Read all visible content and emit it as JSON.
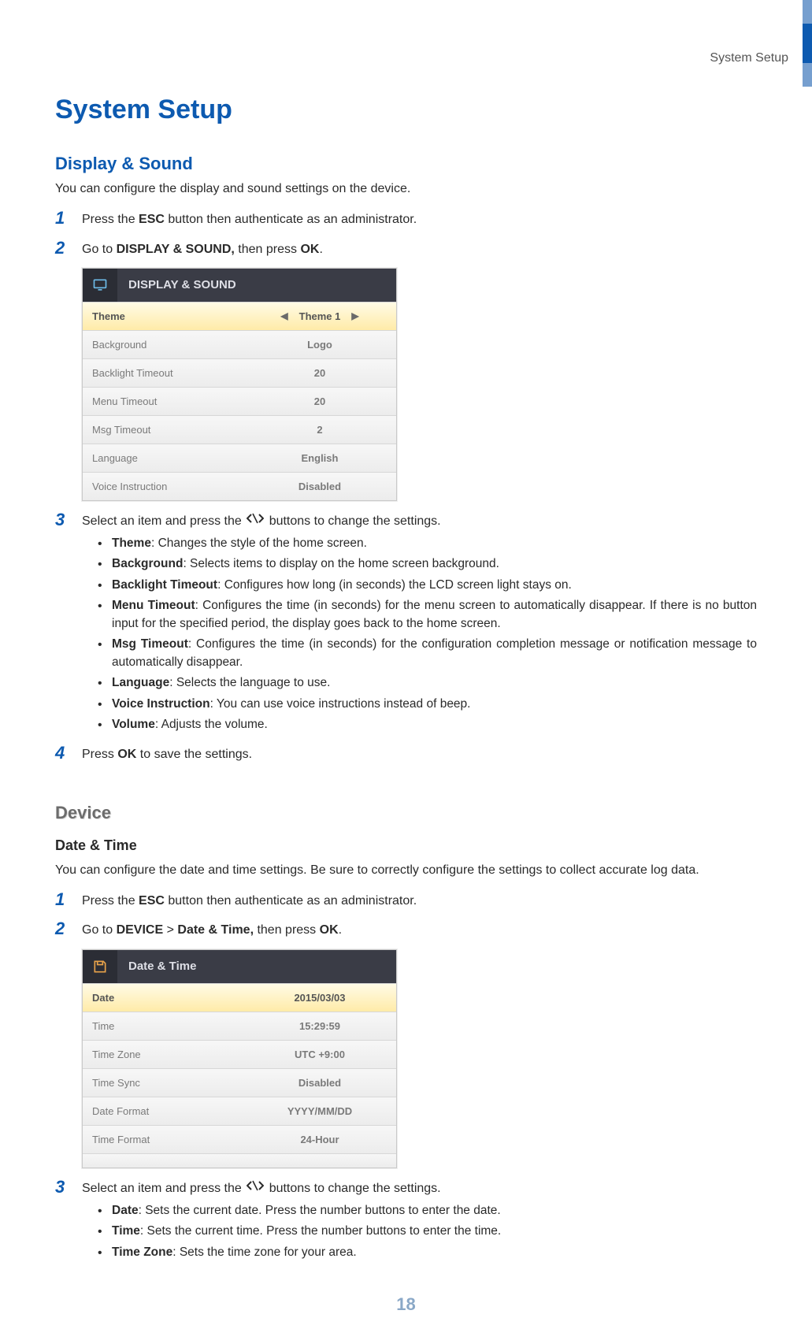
{
  "header": {
    "section": "System Setup"
  },
  "page_number": "18",
  "h1": "System Setup",
  "display_sound": {
    "heading": "Display & Sound",
    "intro": "You can configure the display and sound settings on the device.",
    "steps": {
      "s1_a": "Press the ",
      "s1_b": "ESC",
      "s1_c": " button then authenticate as an administrator.",
      "s2_a": "Go to ",
      "s2_b": "DISPLAY & SOUND,",
      "s2_c": " then press ",
      "s2_d": "OK",
      "s2_e": ".",
      "s3": "Select an item and press the ",
      "s3_tail": " buttons to change the settings.",
      "s4_a": "Press ",
      "s4_b": "OK",
      "s4_c": " to save the settings."
    },
    "panel": {
      "title": "DISPLAY & SOUND",
      "rows": [
        {
          "label": "Theme",
          "value": "Theme 1",
          "arrows": true,
          "selected": true
        },
        {
          "label": "Background",
          "value": "Logo"
        },
        {
          "label": "Backlight Timeout",
          "value": "20"
        },
        {
          "label": "Menu Timeout",
          "value": "20"
        },
        {
          "label": "Msg Timeout",
          "value": "2"
        },
        {
          "label": "Language",
          "value": "English"
        },
        {
          "label": "Voice Instruction",
          "value": "Disabled"
        }
      ]
    },
    "bullets": [
      {
        "b": "Theme",
        "t": ": Changes the style of the home screen."
      },
      {
        "b": "Background",
        "t": ": Selects items to display on the home screen background."
      },
      {
        "b": "Backlight Timeout",
        "t": ": Configures how long (in seconds) the LCD screen light stays on."
      },
      {
        "b": "Menu Timeout",
        "t": ": Configures the time (in seconds) for the menu screen to automatically disappear. If there is no button input for the specified period, the display goes back to the home screen."
      },
      {
        "b": "Msg Timeout",
        "t": ": Configures the time (in seconds) for the configuration completion message or notification message to automatically disappear."
      },
      {
        "b": "Language",
        "t": ": Selects the language to use."
      },
      {
        "b": "Voice Instruction",
        "t": ": You can use voice instructions instead of beep."
      },
      {
        "b": "Volume",
        "t": ": Adjusts the volume."
      }
    ]
  },
  "device": {
    "heading": "Device",
    "sub": "Date & Time",
    "intro": "You can configure the date and time settings. Be sure to correctly configure the settings to collect accurate log data.",
    "steps": {
      "s1_a": "Press the ",
      "s1_b": "ESC",
      "s1_c": " button then authenticate as an administrator.",
      "s2_a": "Go to ",
      "s2_b": "DEVICE",
      "s2_c": " > ",
      "s2_d": "Date & Time,",
      "s2_e": " then press ",
      "s2_f": "OK",
      "s2_g": ".",
      "s3": "Select an item and press the ",
      "s3_tail": " buttons to change the settings."
    },
    "panel": {
      "title": "Date & Time",
      "rows": [
        {
          "label": "Date",
          "value": "2015/03/03",
          "selected": true
        },
        {
          "label": "Time",
          "value": "15:29:59"
        },
        {
          "label": "Time Zone",
          "value": "UTC +9:00"
        },
        {
          "label": "Time Sync",
          "value": "Disabled"
        },
        {
          "label": "Date Format",
          "value": "YYYY/MM/DD"
        },
        {
          "label": "Time Format",
          "value": "24-Hour"
        }
      ]
    },
    "bullets": [
      {
        "b": "Date",
        "t": ": Sets the current date. Press the number buttons to enter the date."
      },
      {
        "b": "Time",
        "t": ": Sets the current time. Press the number buttons to enter the time."
      },
      {
        "b": "Time Zone",
        "t": ": Sets the time zone for your area."
      }
    ]
  }
}
